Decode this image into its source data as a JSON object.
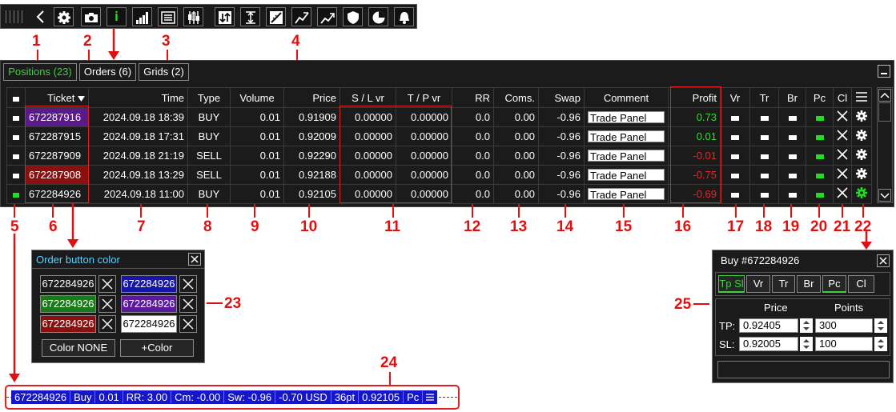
{
  "tabs": [
    {
      "label": "Positions (23)"
    },
    {
      "label": "Orders (6)"
    },
    {
      "label": "Grids (2)"
    }
  ],
  "toolbar": {
    "icons": [
      "back-icon",
      "gear-icon",
      "camera-icon",
      "info-icon",
      "signal-bars-icon",
      "list-icon",
      "candles-icon",
      "sort-icon",
      "range-icon",
      "ruler-icon",
      "trend-icon",
      "trend-up-icon",
      "shield-icon",
      "pie-icon",
      "bell-icon"
    ],
    "info_label": "i"
  },
  "table": {
    "headers": [
      "",
      "Ticket",
      "Time",
      "Type",
      "Volume",
      "Price",
      "S / L vr",
      "T / P vr",
      "RR",
      "Coms.",
      "Swap",
      "Comment",
      "Profit",
      "Vr",
      "Tr",
      "Br",
      "Pc",
      "Cl",
      ""
    ],
    "rows": [
      {
        "ticket": "672287916",
        "time": "2024.09.18 18:39",
        "type": "BUY",
        "volume": "0.01",
        "price": "0.91909",
        "sl": "0.00000",
        "tp": "0.00000",
        "rr": "0.0",
        "coms": "0.00",
        "swap": "-0.96",
        "comment": "Trade Panel",
        "profit": "0.73",
        "ticket_color": "#5a1a8a",
        "profit_color": "#33dd33",
        "check": "#ffffff",
        "gear": "#ffffff"
      },
      {
        "ticket": "672287915",
        "time": "2024.09.18 17:31",
        "type": "BUY",
        "volume": "0.01",
        "price": "0.92009",
        "sl": "0.00000",
        "tp": "0.00000",
        "rr": "0.0",
        "coms": "0.00",
        "swap": "-0.96",
        "comment": "Trade Panel",
        "profit": "0.01",
        "ticket_color": "",
        "profit_color": "#33dd33",
        "check": "#ffffff",
        "gear": "#ffffff"
      },
      {
        "ticket": "672287909",
        "time": "2024.09.18 21:19",
        "type": "SELL",
        "volume": "0.01",
        "price": "0.92290",
        "sl": "0.00000",
        "tp": "0.00000",
        "rr": "0.0",
        "coms": "0.00",
        "swap": "-0.96",
        "comment": "Trade Panel",
        "profit": "-0.01",
        "ticket_color": "",
        "profit_color": "#ee2222",
        "check": "#ffffff",
        "gear": "#ffffff"
      },
      {
        "ticket": "672287908",
        "time": "2024.09.18 13:29",
        "type": "SELL",
        "volume": "0.01",
        "price": "0.92188",
        "sl": "0.00000",
        "tp": "0.00000",
        "rr": "0.0",
        "coms": "0.00",
        "swap": "-0.96",
        "comment": "Trade Panel",
        "profit": "-0.75",
        "ticket_color": "#8a1010",
        "profit_color": "#ee2222",
        "check": "#ffffff",
        "gear": "#ffffff"
      },
      {
        "ticket": "672284926",
        "time": "2024.09.18 11:00",
        "type": "BUY",
        "volume": "0.01",
        "price": "0.92105",
        "sl": "0.00000",
        "tp": "0.00000",
        "rr": "0.0",
        "coms": "0.00",
        "swap": "-0.96",
        "comment": "Trade Panel",
        "profit": "-0.69",
        "ticket_color": "",
        "profit_color": "#ee2222",
        "check": "#22dd22",
        "gear": "#22dd22"
      }
    ]
  },
  "callouts": [
    "1",
    "2",
    "3",
    "4",
    "5",
    "6",
    "7",
    "8",
    "9",
    "10",
    "11",
    "12",
    "13",
    "14",
    "15",
    "16",
    "17",
    "18",
    "19",
    "20",
    "21",
    "22",
    "23",
    "24",
    "25"
  ],
  "order_color": {
    "title": "Order button color",
    "ticket": "672284926",
    "color_none": "Color NONE",
    "add_color": "+Color",
    "swatches": [
      "#1b1b1b",
      "#1515aa",
      "#1a7a1a",
      "#5a1a9a",
      "#8a1010",
      "#ffffff"
    ]
  },
  "trade_popup": {
    "title": "Buy  #672284926",
    "buttons": [
      "Tp Sl",
      "Vr",
      "Tr",
      "Br",
      "Pc",
      "Cl"
    ],
    "price_label": "Price",
    "points_label": "Points",
    "tp_label": "TP:",
    "sl_label": "SL:",
    "tp_price": "0.92405",
    "sl_price": "0.92005",
    "tp_points": "300",
    "sl_points": "100"
  },
  "statusbar": {
    "items": [
      "672284926",
      "Buy",
      "0.01",
      "RR: 3.00",
      "Cm: -0.00",
      "Sw: -0.96",
      "-0.70 USD",
      "36pt",
      "0.92105",
      "Pc"
    ]
  }
}
